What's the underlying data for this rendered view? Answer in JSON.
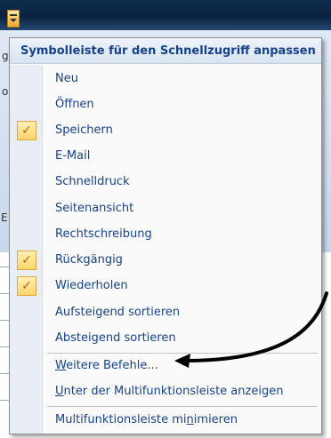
{
  "menu": {
    "title": "Symbolleiste für den Schnellzugriff anpassen",
    "items": [
      {
        "label": "Neu",
        "checked": false
      },
      {
        "label": "Öffnen",
        "checked": false
      },
      {
        "label": "Speichern",
        "checked": true
      },
      {
        "label": "E-Mail",
        "checked": false
      },
      {
        "label": "Schnelldruck",
        "checked": false
      },
      {
        "label": "Seitenansicht",
        "checked": false
      },
      {
        "label": "Rechtschreibung",
        "checked": false
      },
      {
        "label": "Rückgängig",
        "checked": true
      },
      {
        "label": "Wiederholen",
        "checked": true
      },
      {
        "label": "Aufsteigend sortieren",
        "checked": false
      },
      {
        "label": "Absteigend sortieren",
        "checked": false
      }
    ],
    "more_commands": {
      "mnemonic": "W",
      "rest": "eitere Befehle..."
    },
    "show_below_ribbon": {
      "mnemonic": "U",
      "rest": "nter der Multifunktionsleiste anzeigen"
    },
    "minimize_ribbon": {
      "before": "Multifunktionsleiste mi",
      "mnemonic": "n",
      "after": "imieren"
    },
    "check_glyph": "✓"
  },
  "background": {
    "edge_labels": [
      "g",
      "o",
      "E"
    ]
  },
  "colors": {
    "menu_text": "#15428b",
    "check_bg": "#ffd56a",
    "arrow": "#000000"
  }
}
